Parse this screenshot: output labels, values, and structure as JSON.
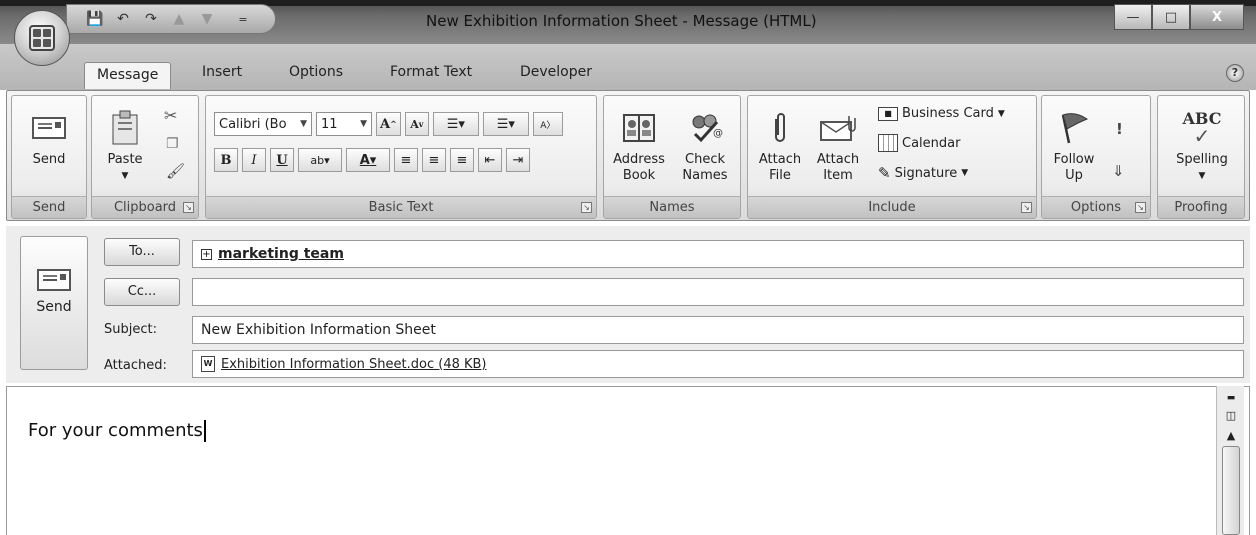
{
  "window": {
    "title": "New Exhibition Information Sheet - Message (HTML)",
    "qat_separator": "="
  },
  "tabs": [
    "Message",
    "Insert",
    "Options",
    "Format Text",
    "Developer"
  ],
  "ribbon": {
    "send_group": {
      "label": "Send",
      "send_button": "Send"
    },
    "clipboard": {
      "label": "Clipboard",
      "paste": "Paste"
    },
    "basic_text": {
      "label": "Basic Text",
      "font_name": "Calibri (Bo",
      "font_size": "11",
      "bold": "B",
      "italic": "I",
      "underline": "U",
      "grow_font": "A",
      "shrink_font": "A",
      "font_color": "A",
      "highlight": "ab"
    },
    "names": {
      "label": "Names",
      "address_book": "Address Book",
      "check_names": "Check Names"
    },
    "include": {
      "label": "Include",
      "attach_file": "Attach File",
      "attach_item": "Attach Item",
      "business_card": "Business Card",
      "calendar": "Calendar",
      "signature": "Signature"
    },
    "options": {
      "label": "Options",
      "follow_up": "Follow Up",
      "importance_high": "!",
      "importance_low": "⇓"
    },
    "proofing": {
      "label": "Proofing",
      "spelling": "Spelling",
      "spelling_icon_text": "ABC"
    }
  },
  "header": {
    "send_button": "Send",
    "to_button": "To...",
    "cc_button": "Cc...",
    "to_value": "marketing team",
    "cc_value": "",
    "subject_label": "Subject:",
    "subject_value": "New Exhibition Information Sheet",
    "attached_label": "Attached:",
    "attachment": "Exhibition Information Sheet.doc (48 KB)"
  },
  "body": {
    "text": "For your comments"
  }
}
